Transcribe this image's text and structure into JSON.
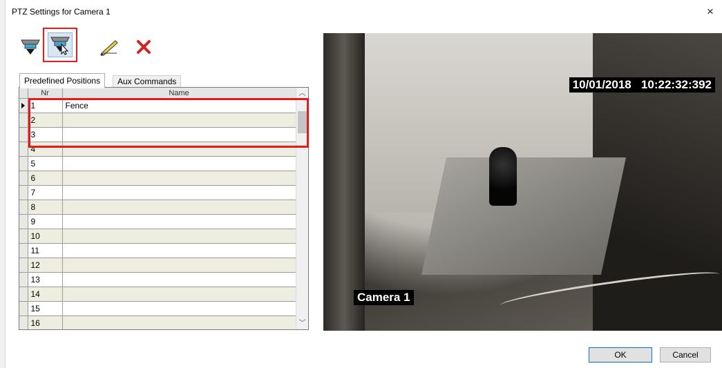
{
  "window": {
    "title": "PTZ Settings for Camera 1",
    "close_glyph": "×"
  },
  "toolbar": {
    "buttons": [
      {
        "name": "camera-go-to-icon"
      },
      {
        "name": "camera-save-position-icon"
      },
      {
        "name": "pencil-edit-icon"
      },
      {
        "name": "delete-x-icon"
      }
    ]
  },
  "tabs": [
    {
      "label": "Predefined Positions",
      "active": true
    },
    {
      "label": "Aux Commands",
      "active": false
    }
  ],
  "grid": {
    "columns": {
      "nr": "Nr",
      "name": "Name"
    },
    "rows": [
      {
        "nr": "1",
        "name": "Fence"
      },
      {
        "nr": "2",
        "name": ""
      },
      {
        "nr": "3",
        "name": ""
      },
      {
        "nr": "4",
        "name": ""
      },
      {
        "nr": "5",
        "name": ""
      },
      {
        "nr": "6",
        "name": ""
      },
      {
        "nr": "7",
        "name": ""
      },
      {
        "nr": "8",
        "name": ""
      },
      {
        "nr": "9",
        "name": ""
      },
      {
        "nr": "10",
        "name": ""
      },
      {
        "nr": "11",
        "name": ""
      },
      {
        "nr": "12",
        "name": ""
      },
      {
        "nr": "13",
        "name": ""
      },
      {
        "nr": "14",
        "name": ""
      },
      {
        "nr": "15",
        "name": ""
      },
      {
        "nr": "16",
        "name": ""
      }
    ]
  },
  "video": {
    "timestamp": "10/01/2018   10:22:32:392",
    "camera_label": "Camera 1"
  },
  "buttons": {
    "ok": "OK",
    "cancel": "Cancel"
  },
  "colors": {
    "highlight": "#e81919",
    "even_row": "#eeeee0",
    "accent": "#0078d7"
  }
}
